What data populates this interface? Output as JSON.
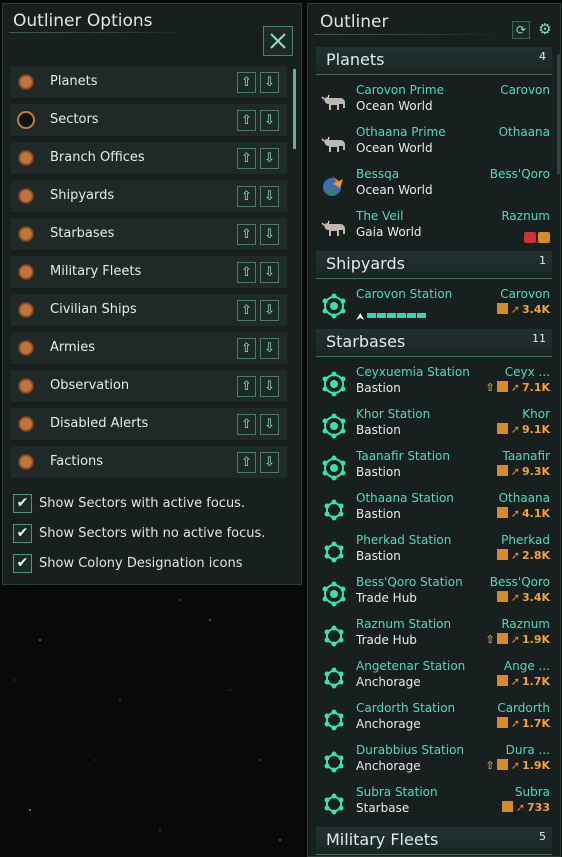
{
  "options_panel": {
    "title": "Outliner Options",
    "items": [
      {
        "label": "Planets",
        "enabled": true
      },
      {
        "label": "Sectors",
        "enabled": false
      },
      {
        "label": "Branch Offices",
        "enabled": true
      },
      {
        "label": "Shipyards",
        "enabled": true
      },
      {
        "label": "Starbases",
        "enabled": true
      },
      {
        "label": "Military Fleets",
        "enabled": true
      },
      {
        "label": "Civilian Ships",
        "enabled": true
      },
      {
        "label": "Armies",
        "enabled": true
      },
      {
        "label": "Observation",
        "enabled": true
      },
      {
        "label": "Disabled Alerts",
        "enabled": true
      },
      {
        "label": "Factions",
        "enabled": true
      }
    ],
    "checks": [
      {
        "label": "Show Sectors with active focus.",
        "checked": true
      },
      {
        "label": "Show Sectors with no active focus.",
        "checked": true
      },
      {
        "label": "Show Colony Designation icons",
        "checked": true
      }
    ]
  },
  "outliner": {
    "title": "Outliner",
    "sections": {
      "planets": {
        "title": "Planets",
        "count": "4"
      },
      "shipyards": {
        "title": "Shipyards",
        "count": "1"
      },
      "starbases": {
        "title": "Starbases",
        "count": "11"
      },
      "military": {
        "title": "Military Fleets",
        "count": "5"
      }
    },
    "planets": [
      {
        "name": "Carovon Prime",
        "type": "Ocean World",
        "location": "Carovon",
        "icon": "cattle-icon"
      },
      {
        "name": "Othaana Prime",
        "type": "Ocean World",
        "location": "Othaana",
        "icon": "cattle-icon"
      },
      {
        "name": "Bessqa",
        "type": "Ocean World",
        "location": "Bess'Qoro",
        "icon": "colony-ship-icon"
      },
      {
        "name": "The Veil",
        "type": "Gaia World",
        "location": "Raznum",
        "icon": "cattle-icon"
      }
    ],
    "shipyards": [
      {
        "name": "Carovon Station",
        "location": "Carovon",
        "power": "3.4K"
      }
    ],
    "starbases": [
      {
        "name": "Ceyxuemia Station",
        "type": "Bastion",
        "location": "Ceyx ...",
        "power": "7.1K",
        "upgrade": true
      },
      {
        "name": "Khor Station",
        "type": "Bastion",
        "location": "Khor",
        "power": "9.1K",
        "upgrade": false
      },
      {
        "name": "Taanafir Station",
        "type": "Bastion",
        "location": "Taanafir",
        "power": "9.3K",
        "upgrade": false
      },
      {
        "name": "Othaana Station",
        "type": "Bastion",
        "location": "Othaana",
        "power": "4.1K",
        "upgrade": false
      },
      {
        "name": "Pherkad Station",
        "type": "Bastion",
        "location": "Pherkad",
        "power": "2.8K",
        "upgrade": false
      },
      {
        "name": "Bess'Qoro Station",
        "type": "Trade Hub",
        "location": "Bess'Qoro",
        "power": "3.4K",
        "upgrade": false
      },
      {
        "name": "Raznum Station",
        "type": "Trade Hub",
        "location": "Raznum",
        "power": "1.9K",
        "upgrade": true
      },
      {
        "name": "Angetenar Station",
        "type": "Anchorage",
        "location": "Ange ...",
        "power": "1.7K",
        "upgrade": false
      },
      {
        "name": "Cardorth Station",
        "type": "Anchorage",
        "location": "Cardorth",
        "power": "1.7K",
        "upgrade": false
      },
      {
        "name": "Durabbius Station",
        "type": "Anchorage",
        "location": "Dura ...",
        "power": "1.9K",
        "upgrade": true
      },
      {
        "name": "Subra Station",
        "type": "Starbase",
        "location": "Subra",
        "power": "733",
        "upgrade": false
      }
    ]
  },
  "colors": {
    "accent": "#58d6b8",
    "power": "#f6a23b",
    "toggle": "#c27b3f"
  }
}
